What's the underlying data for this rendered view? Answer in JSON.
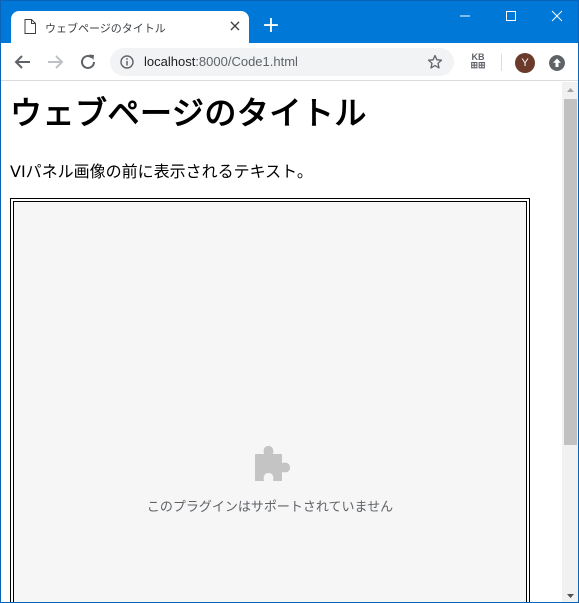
{
  "window": {
    "tab_title": "ウェブページのタイトル",
    "tab_close": "×",
    "new_tab": "+"
  },
  "toolbar": {
    "url_host": "localhost",
    "url_rest": ":8000/Code1.html",
    "kb_label_top": "KB",
    "kb_label_bottom": "⊞⊞",
    "avatar_initial": "Y"
  },
  "page": {
    "heading": "ウェブページのタイトル",
    "paragraph": "VIパネル画像の前に表示されるテキスト。",
    "plugin_message": "このプラグインはサポートされていません"
  },
  "colors": {
    "titlebar": "#0078d7",
    "plugin_bg": "#f6f6f6",
    "scroll_thumb": "#c1c1c1"
  }
}
